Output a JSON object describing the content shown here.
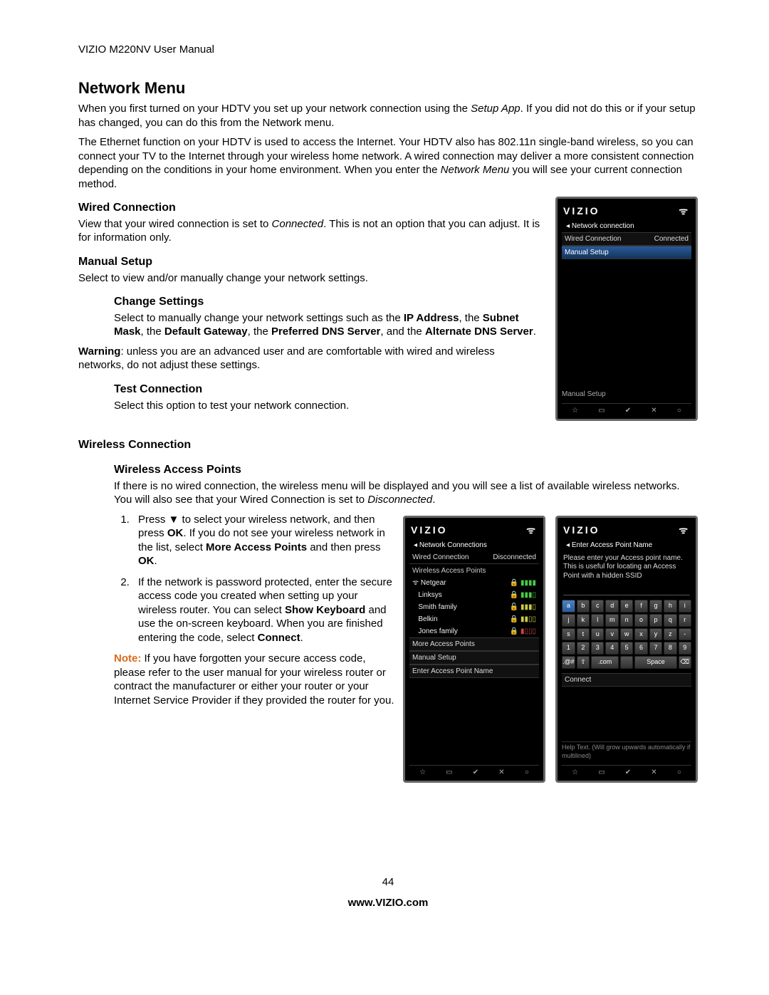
{
  "header": "VIZIO M220NV User Manual",
  "title": "Network Menu",
  "intro1a": "When you first turned on your HDTV you set up your network connection using the ",
  "intro1b": "Setup App",
  "intro1c": ". If you did not do this or if your setup has changed, you can do this from the Network menu.",
  "intro2a": "The Ethernet function on your HDTV is used to access the Internet. Your HDTV also has 802.11n single-band wireless, so you can connect your TV to the Internet through your wireless home network. A wired connection may deliver a more consistent connection depending on the conditions in your home environment. When you enter the ",
  "intro2b": "Network Menu",
  "intro2c": " you will see your current connection method.",
  "wired": {
    "h": "Wired Connection",
    "p1": "View that your wired connection is set to ",
    "p1i": "Connected",
    "p2": ". This is not an option that you can adjust. It is for information only."
  },
  "manual": {
    "h": "Manual Setup",
    "p": "Select to view and/or manually change your network settings."
  },
  "change": {
    "h": "Change Settings",
    "p1": "Select to manually change your network settings such as the ",
    "b1": "IP Address",
    "sep1": ", the ",
    "b2": "Subnet Mask",
    "sep2": ", the ",
    "b3": "Default Gateway",
    "sep3": ", the ",
    "b4": "Preferred DNS Server",
    "sep4": ", and the ",
    "b5": "Alternate DNS Server",
    "sep5": "."
  },
  "warn": {
    "label": "Warning",
    "text": ": unless you are an advanced user and are comfortable with wired and wireless networks, do not adjust these settings."
  },
  "test": {
    "h": "Test Connection",
    "p": "Select this option to test your network connection."
  },
  "wireless": {
    "h1": "Wireless Connection",
    "h2": "Wireless Access Points",
    "p1": "If there is no wired connection, the wireless menu will be displayed and you will see a list of available wireless networks. You will also see that your Wired Connection is set to ",
    "p1i": "Disconnected",
    "p1end": "."
  },
  "steps": {
    "s1a": "Press ▼ to select your wireless network, and then press ",
    "s1b": "OK",
    "s1c": ". If you do not see your wireless network in the list, select ",
    "s1d": "More Access Points",
    "s1e": " and then press ",
    "s1f": "OK",
    "s1g": ".",
    "s2a": "If the network is password protected, enter the secure access code you created when setting up your wireless router. You can select ",
    "s2b": "Show Keyboard",
    "s2c": " and use the on-screen keyboard. When you are finished entering the code, select ",
    "s2d": "Connect",
    "s2e": "."
  },
  "note": {
    "label": "Note:",
    "text": " If you have forgotten your secure access code, please refer to the user manual for your wireless router or contract the manufacturer or either your router or your Internet Service Provider if they provided the router for you."
  },
  "page": "44",
  "site": "www.VIZIO.com",
  "shot1": {
    "brand": "VIZIO",
    "crumb": "Network connection",
    "wired_l": "Wired Connection",
    "wired_v": "Connected",
    "manual": "Manual Setup",
    "hint": "Manual Setup",
    "icons": [
      "☆",
      "▭",
      "✔",
      "✕",
      "○"
    ]
  },
  "shot2": {
    "brand": "VIZIO",
    "crumb": "Network Connections",
    "wired_l": "Wired Connection",
    "wired_v": "Disconnected",
    "sec": "Wireless Access Points",
    "aps": [
      "Netgear",
      "Linksys",
      "Smith family",
      "Belkin",
      "Jones family"
    ],
    "more": "More Access Points",
    "manual": "Manual Setup",
    "enter": "Enter Access Point Name",
    "icons": [
      "☆",
      "▭",
      "✔",
      "✕",
      "○"
    ]
  },
  "shot3": {
    "brand": "VIZIO",
    "crumb": "Enter Access Point Name",
    "msg": "Please enter your Access point name. This is useful for locating an Access Point with a hidden SSID",
    "kb_rows": {
      "r1": [
        "a",
        "b",
        "c",
        "d",
        "e",
        "f",
        "g",
        "h",
        "i"
      ],
      "r2": [
        "j",
        "k",
        "l",
        "m",
        "n",
        "o",
        "p",
        "q",
        "r"
      ],
      "r3": [
        "s",
        "t",
        "u",
        "v",
        "w",
        "x",
        "y",
        "z",
        "-"
      ],
      "r4": [
        "1",
        "2",
        "3",
        "4",
        "5",
        "6",
        "7",
        "8",
        "9"
      ]
    },
    "kb_bottom": {
      "sym": ".@#",
      "shift": "⇧",
      "com": ".com",
      "space": "Space",
      "del": "⌫"
    },
    "connect": "Connect",
    "help": "Help Text. (Will grow upwards automatically if multilined)",
    "icons": [
      "☆",
      "▭",
      "✔",
      "✕",
      "○"
    ]
  }
}
